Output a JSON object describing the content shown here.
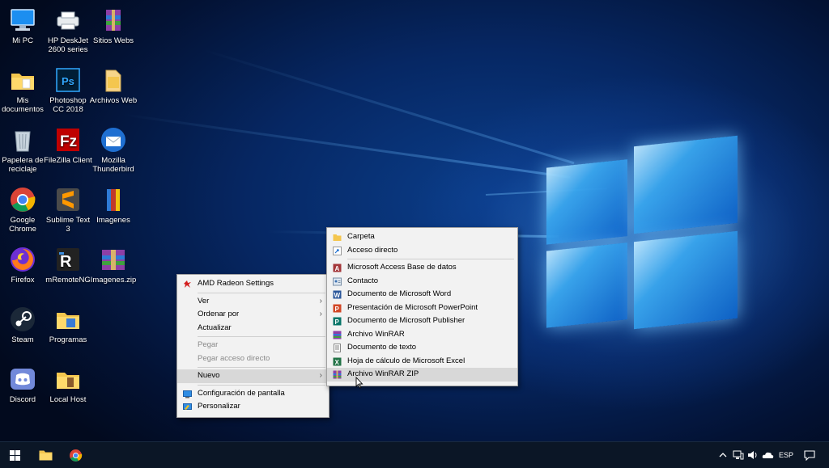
{
  "desktop": {
    "icons": [
      {
        "label": "Mi PC",
        "icon": "computer-icon"
      },
      {
        "label": "HP DeskJet 2600 series",
        "icon": "printer-icon"
      },
      {
        "label": "Sitios Webs",
        "icon": "winrar-icon"
      },
      {
        "label": "Mis documentos",
        "icon": "folder-icon"
      },
      {
        "label": "Photoshop CC 2018",
        "icon": "photoshop-icon"
      },
      {
        "label": "Archivos Web",
        "icon": "folder-icon"
      },
      {
        "label": "Papelera de reciclaje",
        "icon": "recycle-bin-icon"
      },
      {
        "label": "FileZilla Client",
        "icon": "filezilla-icon"
      },
      {
        "label": "Mozilla Thunderbird",
        "icon": "thunderbird-icon"
      },
      {
        "label": "Google Chrome",
        "icon": "chrome-icon"
      },
      {
        "label": "Sublime Text 3",
        "icon": "sublime-text-icon"
      },
      {
        "label": "Imagenes",
        "icon": "winrar-icon"
      },
      {
        "label": "Firefox",
        "icon": "firefox-icon"
      },
      {
        "label": "mRemoteNG",
        "icon": "mremoteng-icon"
      },
      {
        "label": "Imagenes.zip",
        "icon": "winrar-zip-icon"
      },
      {
        "label": "Steam",
        "icon": "steam-icon"
      },
      {
        "label": "Programas",
        "icon": "folder-icon"
      },
      {
        "label": "Discord",
        "icon": "discord-icon"
      },
      {
        "label": "Local Host",
        "icon": "folder-icon"
      }
    ]
  },
  "context_menu": {
    "amd": "AMD Radeon Settings",
    "ver": "Ver",
    "ordenar": "Ordenar por",
    "actualizar": "Actualizar",
    "pegar": "Pegar",
    "pegar_acceso": "Pegar acceso directo",
    "nuevo": "Nuevo",
    "config_pantalla": "Configuración de pantalla",
    "personalizar": "Personalizar",
    "arrow": "›"
  },
  "submenu_nuevo": {
    "items": [
      {
        "label": "Carpeta",
        "icon": "folder-icon"
      },
      {
        "label": "Acceso directo",
        "icon": "shortcut-icon"
      },
      {
        "label": "Microsoft Access Base de datos",
        "icon": "access-icon"
      },
      {
        "label": "Contacto",
        "icon": "contact-icon"
      },
      {
        "label": "Documento de Microsoft Word",
        "icon": "word-icon"
      },
      {
        "label": "Presentación de Microsoft PowerPoint",
        "icon": "powerpoint-icon"
      },
      {
        "label": "Documento de Microsoft Publisher",
        "icon": "publisher-icon"
      },
      {
        "label": "Archivo WinRAR",
        "icon": "winrar-icon"
      },
      {
        "label": "Documento de texto",
        "icon": "text-document-icon"
      },
      {
        "label": "Hoja de cálculo de Microsoft Excel",
        "icon": "excel-icon"
      },
      {
        "label": "Archivo WinRAR ZIP",
        "icon": "winrar-zip-icon"
      }
    ],
    "highlighted": "Archivo WinRAR ZIP"
  },
  "taskbar": {
    "start": "windows-start-icon",
    "pinned": [
      "file-explorer-icon",
      "chrome-icon"
    ],
    "tray": {
      "language": "ESP",
      "icons": [
        "chevron-up-icon",
        "network-icon",
        "volume-icon",
        "onedrive-icon",
        "notifications-icon"
      ]
    }
  },
  "colors": {
    "menu_bg": "#f2f2f2",
    "highlight": "#d8d8d8",
    "taskbar": "#0b1626",
    "accent": "#0f63c9"
  }
}
